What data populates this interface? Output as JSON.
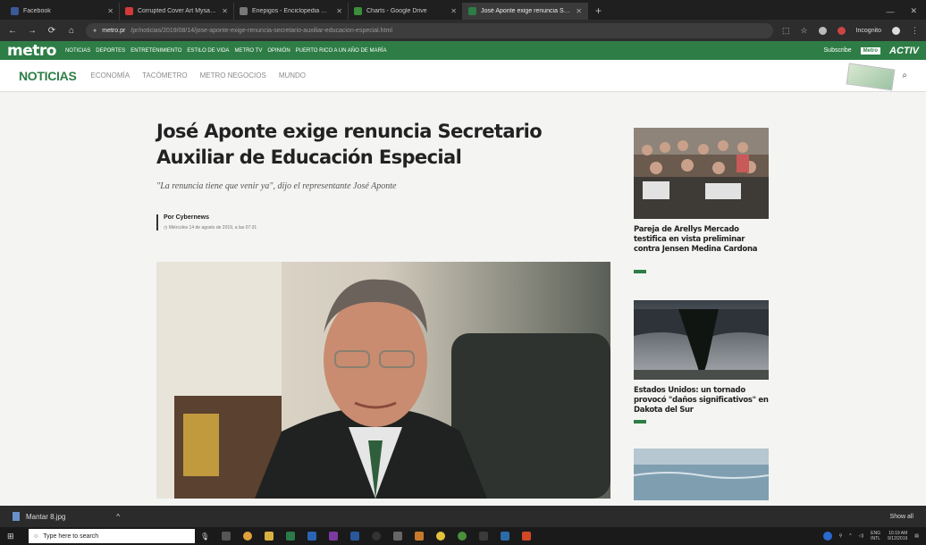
{
  "browser": {
    "tabs": [
      {
        "title": "Facebook",
        "color": "#3b5998"
      },
      {
        "title": "Corrupted Cover Art Mysa - Mu...",
        "color": "#d23a3a"
      },
      {
        "title": "Enepigos - Enciclopedia Mera...",
        "color": "#777777"
      },
      {
        "title": "Charts - Google Drive",
        "color": "#3b8e3b"
      },
      {
        "title": "José Aponte exige renuncia Secr...",
        "color": "#2e7d46"
      }
    ],
    "url_domain": "metro.pr",
    "url_path": "/pr/noticias/2019/08/14/jose-aponte-exige-renuncia-secretario-auxiliar-educacion-especial.html",
    "incognito_label": "Incognito"
  },
  "site": {
    "logo": "metro",
    "top_nav": [
      "NOTICIAS",
      "DEPORTES",
      "ENTRETENIMIENTO",
      "ESTILO DE VIDA",
      "METRO TV",
      "OPINIÓN",
      "PUERTO RICO A UN AÑO DE MARÍA"
    ],
    "subscribe": "Subscribe",
    "badge": "Metro",
    "activ": "ACTIV"
  },
  "section": {
    "title": "NOTICIAS",
    "items": [
      "ECONOMÍA",
      "TACÓMETRO",
      "METRO NEGOCIOS",
      "MUNDO"
    ]
  },
  "article": {
    "headline": "José Aponte exige renuncia Secretario Auxiliar de Educación Especial",
    "subhead": "\"La renuncia tiene que venir ya\", dijo el representante José Aponte",
    "author": "Por Cybernews",
    "date": "Miércoles 14 de agosto de 2019, a las 07:31"
  },
  "sidebar": [
    {
      "title": "Pareja de Arellys Mercado testifica en vista preliminar contra Jensen Medina Cardona"
    },
    {
      "title": "Estados Unidos: un tornado provocó \"daños significativos\" en Dakota del Sur"
    }
  ],
  "downloads": {
    "file": "Mantar 8.jpg",
    "show_all": "Show all"
  },
  "taskbar": {
    "search_placeholder": "Type here to search",
    "lang": "ENG",
    "lang2": "INTL",
    "time": "10:19 AM",
    "date": "9/12/2019"
  }
}
